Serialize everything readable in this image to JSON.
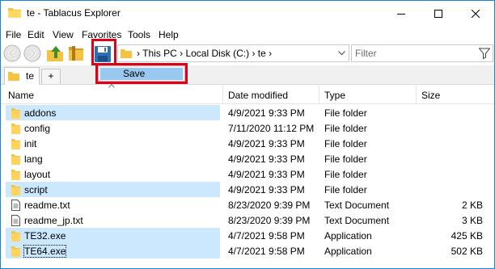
{
  "window": {
    "title": "te - Tablacus Explorer",
    "app_icon": "folder-icon",
    "controls": [
      "minimize-icon",
      "maximize-icon",
      "close-icon"
    ]
  },
  "menu": [
    "File",
    "Edit",
    "View",
    "Favorites",
    "Tools",
    "Help"
  ],
  "toolbar": {
    "icons": [
      "back-icon",
      "forward-icon",
      "up-icon",
      "folder-tree-icon",
      "save-icon"
    ]
  },
  "address": {
    "path": "› This PC › Local Disk (C:) › te ›"
  },
  "filter": {
    "placeholder": "Filter"
  },
  "tabs": {
    "items": [
      {
        "label": "te"
      }
    ],
    "add_label": "+"
  },
  "dropdown": {
    "items": [
      {
        "label": "Save"
      }
    ]
  },
  "columns": [
    "Name",
    "Date modified",
    "Type",
    "Size"
  ],
  "files": [
    {
      "name": "addons",
      "date": "4/9/2021 9:33 PM",
      "type": "File folder",
      "size": "",
      "kind": "folder",
      "selected": true
    },
    {
      "name": "config",
      "date": "7/11/2020 11:12 PM",
      "type": "File folder",
      "size": "",
      "kind": "folder",
      "selected": false
    },
    {
      "name": "init",
      "date": "4/9/2021 9:33 PM",
      "type": "File folder",
      "size": "",
      "kind": "folder",
      "selected": false
    },
    {
      "name": "lang",
      "date": "4/9/2021 9:33 PM",
      "type": "File folder",
      "size": "",
      "kind": "folder",
      "selected": false
    },
    {
      "name": "layout",
      "date": "4/9/2021 9:33 PM",
      "type": "File folder",
      "size": "",
      "kind": "folder",
      "selected": false
    },
    {
      "name": "script",
      "date": "4/9/2021 9:33 PM",
      "type": "File folder",
      "size": "",
      "kind": "folder",
      "selected": true
    },
    {
      "name": "readme.txt",
      "date": "8/23/2020 9:39 PM",
      "type": "Text Document",
      "size": "2 KB",
      "kind": "text",
      "selected": false
    },
    {
      "name": "readme_jp.txt",
      "date": "8/23/2020 9:39 PM",
      "type": "Text Document",
      "size": "3 KB",
      "kind": "text",
      "selected": false
    },
    {
      "name": "TE32.exe",
      "date": "4/7/2021 9:58 PM",
      "type": "Application",
      "size": "425 KB",
      "kind": "app",
      "selected": true
    },
    {
      "name": "TE64.exe",
      "date": "4/7/2021 9:58 PM",
      "type": "Application",
      "size": "502 KB",
      "kind": "app",
      "selected": true
    }
  ],
  "colors": {
    "accent": "#1883d7",
    "selection": "#cce8ff",
    "highlight": "#e0001a",
    "folder": "#f5c342"
  }
}
